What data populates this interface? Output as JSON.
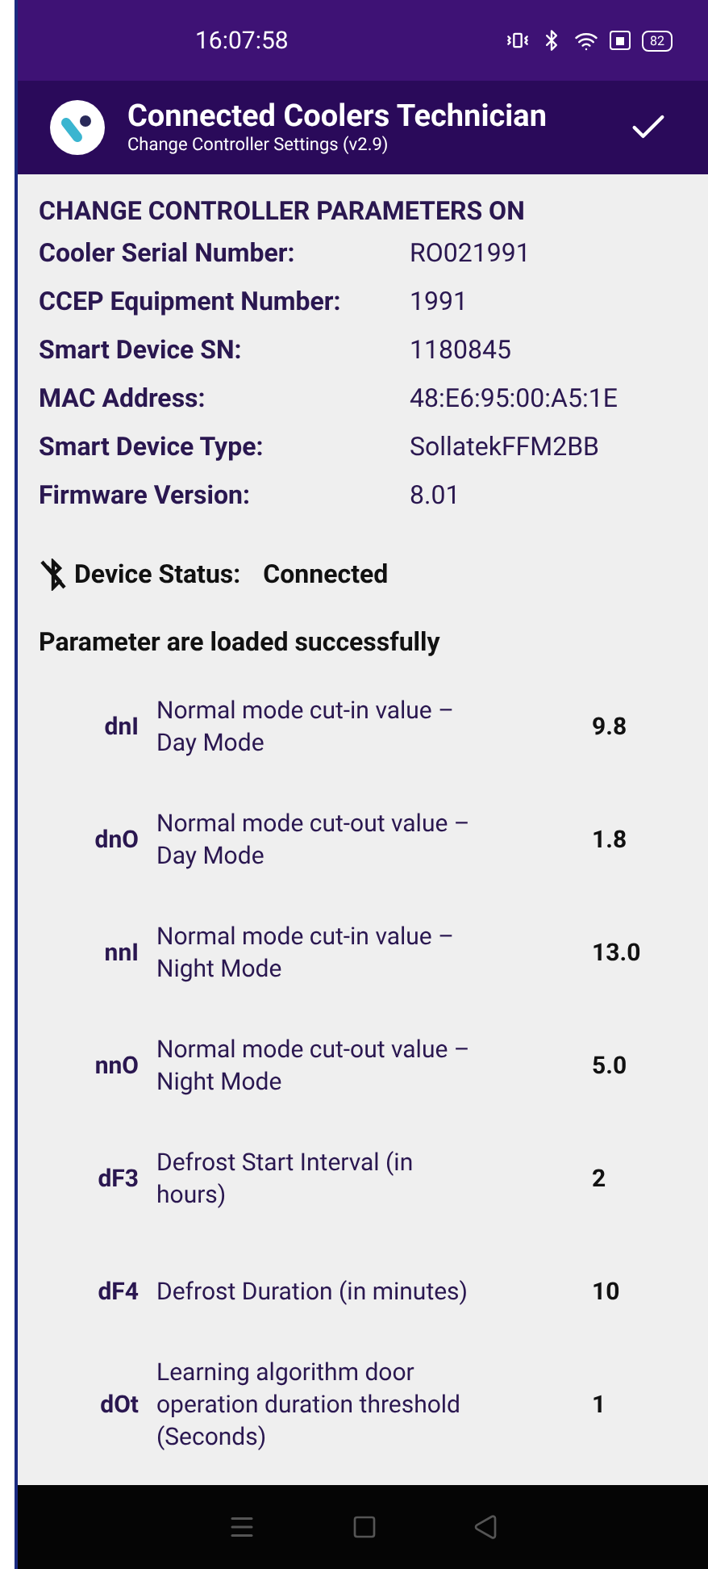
{
  "status_bar": {
    "time": "16:07:58",
    "battery": "82"
  },
  "app_bar": {
    "title": "Connected Coolers Technician",
    "subtitle": "Change Controller Settings (v2.9)"
  },
  "heading": "CHANGE CONTROLLER PARAMETERS ON",
  "info": [
    {
      "label": "Cooler Serial Number:",
      "value": "RO021991"
    },
    {
      "label": "CCEP Equipment Number:",
      "value": "1991"
    },
    {
      "label": "Smart Device SN:",
      "value": "1180845"
    },
    {
      "label": "MAC Address:",
      "value": "48:E6:95:00:A5:1E"
    },
    {
      "label": "Smart Device Type:",
      "value": "SollatekFFM2BB"
    },
    {
      "label": "Firmware Version:",
      "value": "8.01"
    }
  ],
  "device_status": {
    "label": "Device Status:",
    "value": "Connected"
  },
  "load_message": "Parameter are loaded successfully",
  "parameters": [
    {
      "code": "dnI",
      "description": "Normal mode cut-in value – Day Mode",
      "value": "9.8"
    },
    {
      "code": "dnO",
      "description": "Normal mode cut-out value – Day Mode",
      "value": "1.8"
    },
    {
      "code": "nnI",
      "description": "Normal mode cut-in value – Night Mode",
      "value": "13.0"
    },
    {
      "code": "nnO",
      "description": "Normal mode cut-out value – Night Mode",
      "value": "5.0"
    },
    {
      "code": "dF3",
      "description": "Defrost Start Interval (in hours)",
      "value": "2"
    },
    {
      "code": "dF4",
      "description": "Defrost Duration (in minutes)",
      "value": "10"
    },
    {
      "code": "dOt",
      "description": "Learning algorithm door operation duration threshold (Seconds)",
      "value": "1"
    }
  ]
}
